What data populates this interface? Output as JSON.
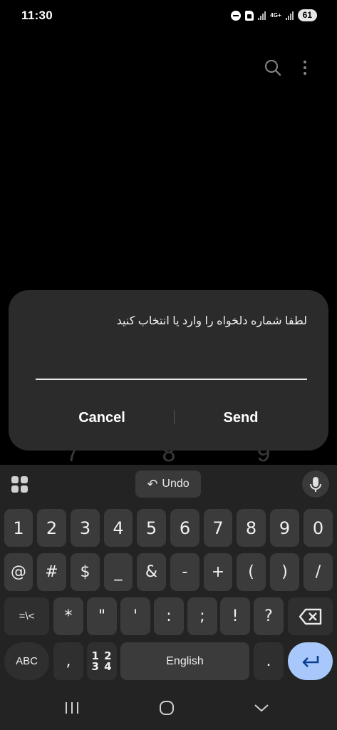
{
  "status_bar": {
    "time": "11:30",
    "network": "4G+",
    "battery": "61",
    "icons": [
      "dnd-icon",
      "sim-icon",
      "signal-icon",
      "signal-icon",
      "battery-icon"
    ]
  },
  "app_bar": {
    "icons": [
      "search-icon",
      "more-vert-icon"
    ]
  },
  "background_keypad": {
    "digits": [
      "7",
      "8",
      "9"
    ]
  },
  "dialog": {
    "title": "لطفا شماره دلخواه را وارد یا انتخاب کنید",
    "input_value": "",
    "cancel_label": "Cancel",
    "send_label": "Send"
  },
  "keyboard": {
    "toolbar": {
      "undo_label": "Undo",
      "icons": [
        "apps-grid-icon",
        "undo-icon",
        "mic-icon"
      ]
    },
    "row1": [
      "1",
      "2",
      "3",
      "4",
      "5",
      "6",
      "7",
      "8",
      "9",
      "0"
    ],
    "row2": [
      "@",
      "#",
      "$",
      "_",
      "&",
      "-",
      "+",
      "(",
      ")",
      "/"
    ],
    "row3": {
      "switch_label": "=\\<",
      "keys": [
        "*",
        "\"",
        "'",
        ":",
        ";",
        "!",
        "?"
      ],
      "backspace_icon": "backspace-icon"
    },
    "row4": {
      "abc_label": "ABC",
      "comma": ",",
      "numpad_line1": "1 2",
      "numpad_line2": "3 4",
      "space_label": "English",
      "period": ".",
      "enter_icon": "enter-icon"
    },
    "accent_color": "#a8c7fa"
  },
  "nav_bar": {
    "icons": [
      "recents-icon",
      "home-icon",
      "back-icon"
    ]
  }
}
